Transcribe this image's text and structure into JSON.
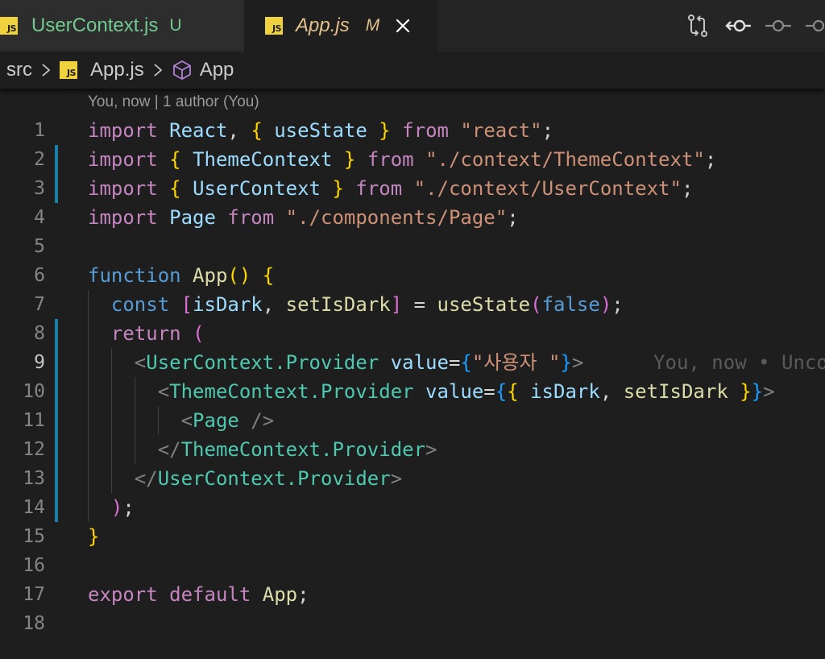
{
  "tabs": [
    {
      "badge": "JS",
      "name": "UserContext.js",
      "status": "U",
      "active": false
    },
    {
      "badge": "JS",
      "name": "App.js",
      "status": "M",
      "active": true
    }
  ],
  "toolbar_icons": [
    "git-compare-icon",
    "go-back-icon",
    "go-forward-icon",
    "more-icon"
  ],
  "breadcrumbs": {
    "folder": "src",
    "file_badge": "JS",
    "file": "App.js",
    "symbol": "App"
  },
  "editor": {
    "codelens": "You, now | 1 author (You)",
    "blame": "You, now • Unco",
    "line_numbers": [
      "1",
      "2",
      "3",
      "4",
      "5",
      "6",
      "7",
      "8",
      "9",
      "10",
      "11",
      "12",
      "13",
      "14",
      "15",
      "16",
      "17",
      "18"
    ],
    "current_line": "9",
    "lines": [
      [
        [
          "kw",
          "import"
        ],
        [
          "pun",
          " "
        ],
        [
          "var",
          "React"
        ],
        [
          "pun",
          ", "
        ],
        [
          "b1",
          "{"
        ],
        [
          "pun",
          " "
        ],
        [
          "var",
          "useState"
        ],
        [
          "pun",
          " "
        ],
        [
          "b1",
          "}"
        ],
        [
          "pun",
          " "
        ],
        [
          "kw",
          "from"
        ],
        [
          "pun",
          " "
        ],
        [
          "str",
          "\"react\""
        ],
        [
          "pun",
          ";"
        ]
      ],
      [
        [
          "kw",
          "import"
        ],
        [
          "pun",
          " "
        ],
        [
          "b1",
          "{"
        ],
        [
          "pun",
          " "
        ],
        [
          "var",
          "ThemeContext"
        ],
        [
          "pun",
          " "
        ],
        [
          "b1",
          "}"
        ],
        [
          "pun",
          " "
        ],
        [
          "kw",
          "from"
        ],
        [
          "pun",
          " "
        ],
        [
          "str",
          "\"./context/ThemeContext\""
        ],
        [
          "pun",
          ";"
        ]
      ],
      [
        [
          "kw",
          "import"
        ],
        [
          "pun",
          " "
        ],
        [
          "b1",
          "{"
        ],
        [
          "pun",
          " "
        ],
        [
          "var",
          "UserContext"
        ],
        [
          "pun",
          " "
        ],
        [
          "b1",
          "}"
        ],
        [
          "pun",
          " "
        ],
        [
          "kw",
          "from"
        ],
        [
          "pun",
          " "
        ],
        [
          "str",
          "\"./context/UserContext\""
        ],
        [
          "pun",
          ";"
        ]
      ],
      [
        [
          "kw",
          "import"
        ],
        [
          "pun",
          " "
        ],
        [
          "var",
          "Page"
        ],
        [
          "pun",
          " "
        ],
        [
          "kw",
          "from"
        ],
        [
          "pun",
          " "
        ],
        [
          "str",
          "\"./components/Page\""
        ],
        [
          "pun",
          ";"
        ]
      ],
      [],
      [
        [
          "kw2",
          "function"
        ],
        [
          "pun",
          " "
        ],
        [
          "fn",
          "App"
        ],
        [
          "b1",
          "()"
        ],
        [
          "pun",
          " "
        ],
        [
          "b1",
          "{"
        ]
      ],
      [
        [
          "pun",
          "  "
        ],
        [
          "kw2",
          "const"
        ],
        [
          "pun",
          " "
        ],
        [
          "b2",
          "["
        ],
        [
          "var",
          "isDark"
        ],
        [
          "pun",
          ", "
        ],
        [
          "fn",
          "setIsDark"
        ],
        [
          "b2",
          "]"
        ],
        [
          "pun",
          " = "
        ],
        [
          "fn",
          "useState"
        ],
        [
          "b2",
          "("
        ],
        [
          "kw2",
          "false"
        ],
        [
          "b2",
          ")"
        ],
        [
          "pun",
          ";"
        ]
      ],
      [
        [
          "pun",
          "  "
        ],
        [
          "kw",
          "return"
        ],
        [
          "pun",
          " "
        ],
        [
          "b2",
          "("
        ]
      ],
      [
        [
          "pun",
          "    "
        ],
        [
          "tag",
          "<"
        ],
        [
          "cls",
          "UserContext.Provider"
        ],
        [
          "pun",
          " "
        ],
        [
          "var",
          "value"
        ],
        [
          "pun",
          "="
        ],
        [
          "b3",
          "{"
        ],
        [
          "str",
          "\"사용자 \""
        ],
        [
          "b3",
          "}"
        ],
        [
          "tag",
          ">"
        ]
      ],
      [
        [
          "pun",
          "      "
        ],
        [
          "tag",
          "<"
        ],
        [
          "cls",
          "ThemeContext.Provider"
        ],
        [
          "pun",
          " "
        ],
        [
          "var",
          "value"
        ],
        [
          "pun",
          "="
        ],
        [
          "b3",
          "{"
        ],
        [
          "b1",
          "{"
        ],
        [
          "pun",
          " "
        ],
        [
          "var",
          "isDark"
        ],
        [
          "pun",
          ", "
        ],
        [
          "fn",
          "setIsDark"
        ],
        [
          "pun",
          " "
        ],
        [
          "b1",
          "}"
        ],
        [
          "b3",
          "}"
        ],
        [
          "tag",
          ">"
        ]
      ],
      [
        [
          "pun",
          "        "
        ],
        [
          "tag",
          "<"
        ],
        [
          "cls",
          "Page"
        ],
        [
          "pun",
          " "
        ],
        [
          "tag",
          "/>"
        ]
      ],
      [
        [
          "pun",
          "      "
        ],
        [
          "tag",
          "</"
        ],
        [
          "cls",
          "ThemeContext.Provider"
        ],
        [
          "tag",
          ">"
        ]
      ],
      [
        [
          "pun",
          "    "
        ],
        [
          "tag",
          "</"
        ],
        [
          "cls",
          "UserContext.Provider"
        ],
        [
          "tag",
          ">"
        ]
      ],
      [
        [
          "pun",
          "  "
        ],
        [
          "b2",
          ")"
        ],
        [
          "pun",
          ";"
        ]
      ],
      [
        [
          "b1",
          "}"
        ]
      ],
      [],
      [
        [
          "kw",
          "export"
        ],
        [
          "pun",
          " "
        ],
        [
          "kw",
          "default"
        ],
        [
          "pun",
          " "
        ],
        [
          "fn",
          "App"
        ],
        [
          "pun",
          ";"
        ]
      ],
      []
    ],
    "modified_lines": [
      "2",
      "3",
      "8",
      "9",
      "10",
      "11",
      "12",
      "13",
      "14"
    ]
  },
  "colors": {
    "background": "#1e1e1e",
    "tab_untracked": "#73c991",
    "tab_modified": "#e2c08d",
    "js_badge": "#f0d23e",
    "gutter_modified": "#1b81a8"
  }
}
